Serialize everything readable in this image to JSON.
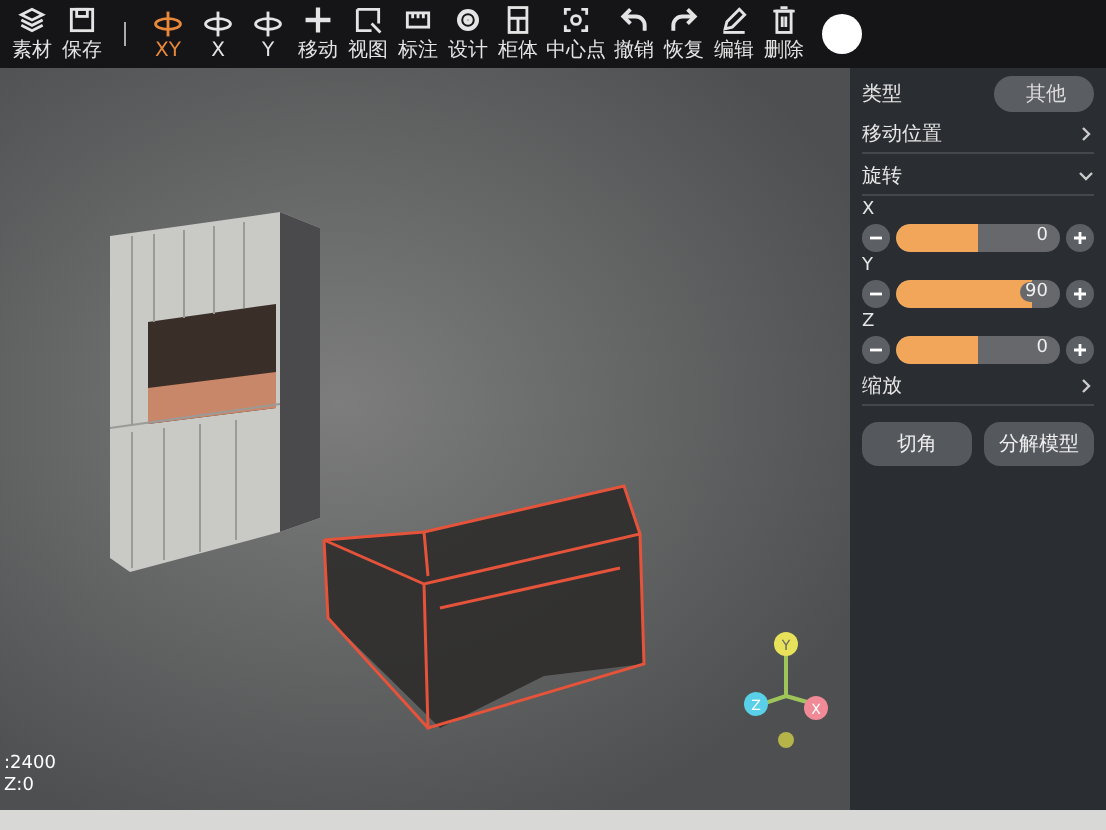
{
  "toolbar": {
    "tools": [
      {
        "kind": "button",
        "label": "素材",
        "selected": false
      },
      {
        "kind": "button",
        "label": "保存",
        "selected": false
      },
      {
        "kind": "divider"
      },
      {
        "kind": "button",
        "label": "XY",
        "selected": true
      },
      {
        "kind": "button",
        "label": "X",
        "selected": false
      },
      {
        "kind": "button",
        "label": "Y",
        "selected": false
      },
      {
        "kind": "button",
        "label": "移动",
        "selected": false
      },
      {
        "kind": "button",
        "label": "视图",
        "selected": false
      },
      {
        "kind": "button",
        "label": "标注",
        "selected": false
      },
      {
        "kind": "button",
        "label": "设计",
        "selected": false
      },
      {
        "kind": "button",
        "label": "柜体",
        "selected": false
      },
      {
        "kind": "button",
        "label": "中心点",
        "selected": false
      },
      {
        "kind": "button",
        "label": "撤销",
        "selected": false
      },
      {
        "kind": "button",
        "label": "恢复",
        "selected": false
      },
      {
        "kind": "button",
        "label": "编辑",
        "selected": false
      },
      {
        "kind": "button",
        "label": "删除",
        "selected": false
      },
      {
        "kind": "swatch"
      }
    ]
  },
  "panel": {
    "rows": [
      {
        "kind": "select",
        "label": "类型",
        "value": "其他"
      },
      {
        "kind": "section",
        "label": "移动位置",
        "expanded": false
      },
      {
        "kind": "section",
        "label": "旋转",
        "expanded": true
      },
      {
        "kind": "slider",
        "label": "X",
        "value": "0",
        "level": 0.5
      },
      {
        "kind": "slider",
        "label": "Y",
        "value": "90",
        "level": 0.83
      },
      {
        "kind": "slider",
        "label": "Z",
        "value": "0",
        "level": 0.5
      },
      {
        "kind": "section",
        "label": "缩放",
        "expanded": false
      }
    ],
    "buttons": [
      "切角",
      "分解模型"
    ]
  },
  "viewport": {
    "coordinates": [
      ":2400",
      "Z:0"
    ],
    "axes": [
      "Y",
      "Z",
      "X"
    ]
  }
}
